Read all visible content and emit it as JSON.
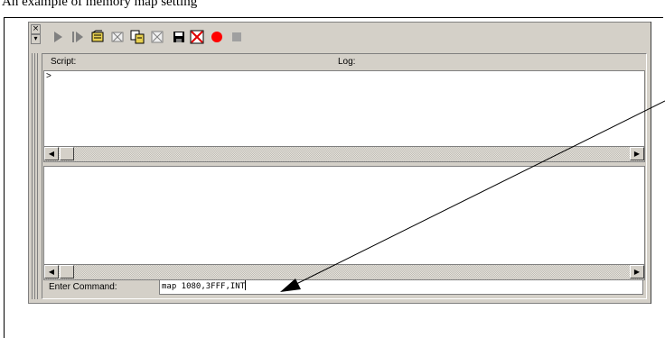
{
  "caption": "An example of memory map setting",
  "toolbar": {
    "items": [
      {
        "name": "run-icon"
      },
      {
        "name": "step-icon"
      },
      {
        "name": "open-script-icon"
      },
      {
        "name": "close-script-icon"
      },
      {
        "name": "copy-icon"
      },
      {
        "name": "clear-icon"
      },
      {
        "name": "save-icon"
      },
      {
        "name": "disable-log-icon"
      },
      {
        "name": "record-icon"
      },
      {
        "name": "stop-icon"
      }
    ]
  },
  "panel": {
    "script_label": "Script:",
    "log_label": "Log:",
    "prompt": ">",
    "command_label": "Enter Command:",
    "command_value": "map 1080,3FFF,INT"
  },
  "colors": {
    "record": "#ff0000",
    "window_bg": "#d4d0c8"
  }
}
